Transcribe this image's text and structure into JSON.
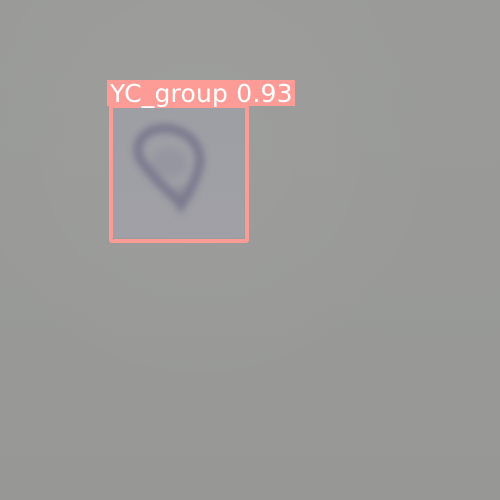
{
  "image": {
    "background_color": "#999a98",
    "object_color": "#6f6f88"
  },
  "detection": {
    "label": "YC_group 0.93",
    "box_color": "#fd9c97",
    "label_text_color": "#ffffff"
  }
}
